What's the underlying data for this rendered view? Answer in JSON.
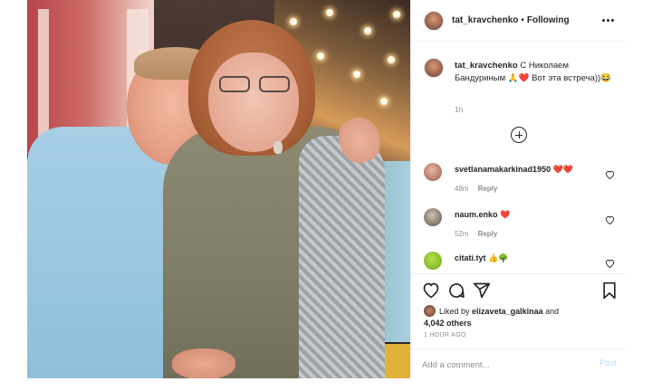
{
  "post": {
    "author": "tat_kravchenko",
    "separator": "•",
    "follow_state": "Following",
    "caption_user": "tat_kravchenko",
    "caption_text": "С Николаем Бандуриным 🙏❤️ Вот эта встреча))😂",
    "caption_time": "1h"
  },
  "comments": [
    {
      "user": "svetlanamakarkinad1950",
      "text": "❤️❤️",
      "time": "48m",
      "reply": "Reply"
    },
    {
      "user": "naum.enko",
      "text": "❤️",
      "time": "52m",
      "reply": "Reply"
    },
    {
      "user": "citati.tyt",
      "text": "👍🌳",
      "time": "",
      "reply": ""
    }
  ],
  "likes": {
    "prefix": "Liked by",
    "user": "elizaveta_galkinaa",
    "joiner": "and",
    "count": "4,042 others"
  },
  "posted_ago": "1 HOUR AGO",
  "add_comment": {
    "placeholder": "Add a comment...",
    "post_label": "Post"
  },
  "colors": {
    "post_button": "#b2dffc",
    "heart_red": "#ed4956",
    "muted": "#8e8e8e"
  },
  "icons": [
    "more-icon",
    "add-comments-icon",
    "heart-icon",
    "comment-icon",
    "share-icon",
    "bookmark-icon"
  ]
}
